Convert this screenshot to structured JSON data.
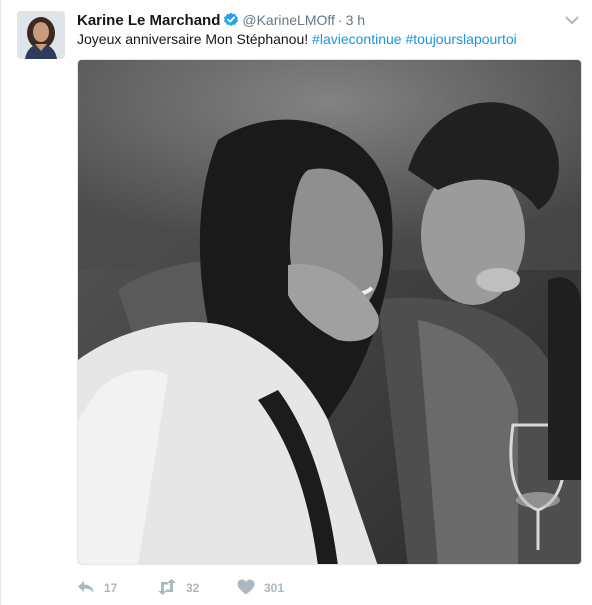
{
  "tweet": {
    "author_name": "Karine Le Marchand",
    "handle": "@KarineLMOff",
    "separator": "·",
    "time": "3 h",
    "text_plain": "Joyeux anniversaire Mon Stéphanou!",
    "hashtags": [
      "#laviecontinue",
      "#toujourslapourtoi"
    ],
    "verified": true,
    "icons": {
      "verified": "verified-badge-icon",
      "menu": "chevron-down-icon",
      "reply": "reply-icon",
      "retweet": "retweet-icon",
      "like": "heart-icon"
    },
    "media": {
      "type": "photo",
      "style": "black-and-white"
    },
    "actions": {
      "replies": "17",
      "retweets": "32",
      "likes": "301"
    }
  },
  "colors": {
    "link": "#1b95e0",
    "verified": "#1da1f2",
    "muted": "#657786",
    "action_icon": "#aab8c2",
    "text": "#14171a"
  }
}
